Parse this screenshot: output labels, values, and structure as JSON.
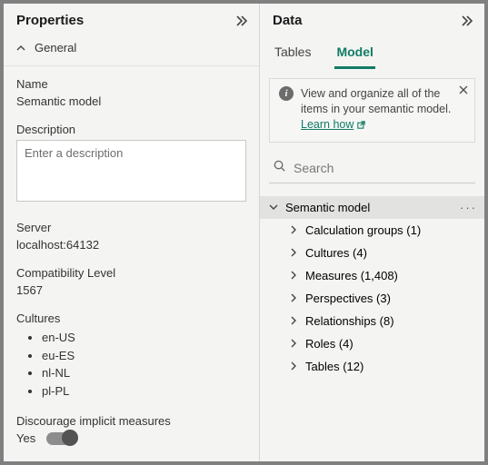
{
  "properties": {
    "title": "Properties",
    "section": "General",
    "name_label": "Name",
    "name_value": "Semantic model",
    "description_label": "Description",
    "description_placeholder": "Enter a description",
    "description_value": "",
    "server_label": "Server",
    "server_value": "localhost:64132",
    "compat_label": "Compatibility Level",
    "compat_value": "1567",
    "cultures_label": "Cultures",
    "cultures": [
      "en-US",
      "eu-ES",
      "nl-NL",
      "pl-PL"
    ],
    "discourage_label": "Discourage implicit measures",
    "discourage_value": "Yes"
  },
  "data": {
    "title": "Data",
    "tabs": {
      "tables": "Tables",
      "model": "Model",
      "active": "Model"
    },
    "info": {
      "text": "View and organize all of the items in your semantic model.",
      "link": "Learn how"
    },
    "search_placeholder": "Search",
    "tree": {
      "root": "Semantic model",
      "items": [
        {
          "label": "Calculation groups",
          "count": 1
        },
        {
          "label": "Cultures",
          "count": 4
        },
        {
          "label": "Measures",
          "count": 1408
        },
        {
          "label": "Perspectives",
          "count": 3
        },
        {
          "label": "Relationships",
          "count": 8
        },
        {
          "label": "Roles",
          "count": 4
        },
        {
          "label": "Tables",
          "count": 12
        }
      ]
    }
  }
}
